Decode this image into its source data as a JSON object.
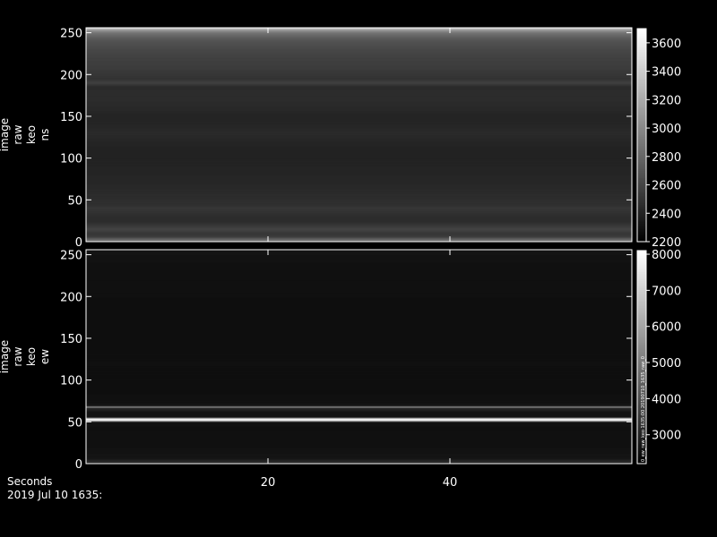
{
  "chart_data": [
    {
      "type": "heatmap",
      "panel": "top",
      "ylabel": [
        "image",
        "raw",
        "keo",
        "ns"
      ],
      "y_ticks": [
        0,
        50,
        100,
        150,
        200,
        250
      ],
      "ylim": [
        0,
        256
      ],
      "x_ticks": [
        20,
        40
      ],
      "xlim": [
        0,
        60
      ],
      "colorbar": {
        "ticks": [
          2200,
          2400,
          2600,
          2800,
          3000,
          3200,
          3400,
          3600
        ],
        "range": [
          2200,
          3700
        ]
      },
      "row_profile": {
        "rows": [
          0,
          3,
          6,
          10,
          15,
          20,
          25,
          30,
          35,
          40,
          45,
          50,
          60,
          70,
          80,
          90,
          100,
          110,
          120,
          130,
          140,
          150,
          160,
          170,
          180,
          186,
          190,
          195,
          200,
          210,
          220,
          230,
          240,
          245,
          250,
          253,
          256
        ],
        "values": [
          2900,
          2800,
          2560,
          2520,
          2600,
          2520,
          2460,
          2460,
          2490,
          2520,
          2480,
          2470,
          2450,
          2430,
          2420,
          2410,
          2400,
          2400,
          2420,
          2450,
          2420,
          2410,
          2440,
          2460,
          2460,
          2450,
          2580,
          2500,
          2520,
          2560,
          2580,
          2620,
          2680,
          2760,
          2880,
          3050,
          3400
        ]
      }
    },
    {
      "type": "heatmap",
      "panel": "bottom",
      "ylabel": [
        "image",
        "raw",
        "keo",
        "ew"
      ],
      "y_ticks": [
        0,
        50,
        100,
        150,
        200,
        250
      ],
      "ylim": [
        0,
        256
      ],
      "x_ticks": [
        20,
        40
      ],
      "xlim": [
        0,
        60
      ],
      "colorbar": {
        "ticks": [
          3000,
          4000,
          5000,
          6000,
          7000,
          8000
        ],
        "range": [
          2200,
          8100
        ]
      },
      "colorbar_vertical_text": "0_ew_raw_keo 1635:00 20190710_1635_raw_0",
      "row_profile": {
        "rows": [
          0,
          3,
          6,
          12,
          20,
          30,
          40,
          50,
          52,
          53,
          54,
          56,
          62,
          67,
          68,
          69,
          71,
          80,
          100,
          120,
          150,
          180,
          200,
          220,
          240,
          250,
          256
        ],
        "values": [
          2900,
          3200,
          2700,
          2650,
          2600,
          2580,
          2560,
          2650,
          7800,
          8000,
          7400,
          2620,
          2620,
          3200,
          6200,
          3200,
          2620,
          2560,
          2550,
          2560,
          2540,
          2540,
          2560,
          2580,
          2600,
          2650,
          2700
        ]
      }
    }
  ],
  "footer": {
    "xlabel": "Seconds",
    "timestamp": "2019 Jul 10 1635:"
  }
}
